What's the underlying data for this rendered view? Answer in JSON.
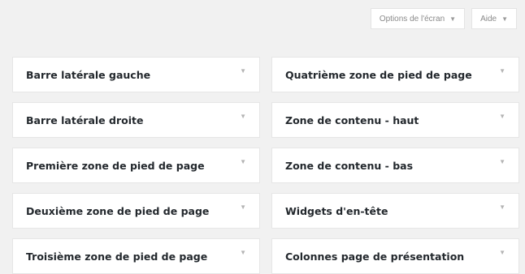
{
  "screen_meta": {
    "screen_options_label": "Options de l'écran",
    "help_label": "Aide",
    "caret_icon": "▼"
  },
  "widget_areas": {
    "left": [
      {
        "label": "Barre latérale gauche"
      },
      {
        "label": "Barre latérale droite"
      },
      {
        "label": "Première zone de pied de page"
      },
      {
        "label": "Deuxième zone de pied de page"
      },
      {
        "label": "Troisième zone de pied de page"
      }
    ],
    "right": [
      {
        "label": "Quatrième zone de pied de page"
      },
      {
        "label": "Zone de contenu - haut"
      },
      {
        "label": "Zone de contenu - bas"
      },
      {
        "label": "Widgets d'en-tête"
      },
      {
        "label": "Colonnes page de présentation"
      }
    ],
    "toggle_icon": "▼"
  }
}
